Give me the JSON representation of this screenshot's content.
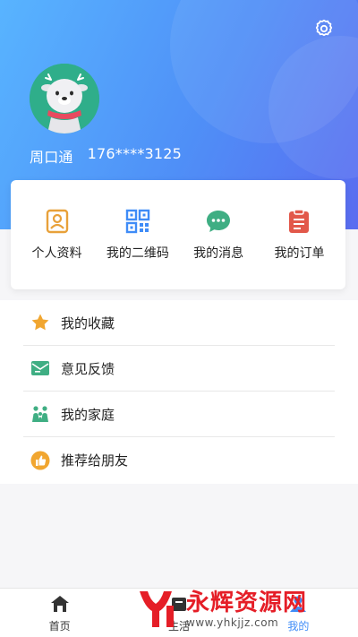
{
  "profile": {
    "name": "周口通",
    "phone": "176****3125"
  },
  "quick_actions": [
    {
      "label": "个人资料",
      "icon": "profile-card-icon",
      "color": "#e8a13a"
    },
    {
      "label": "我的二维码",
      "icon": "qr-code-icon",
      "color": "#3f8cf7"
    },
    {
      "label": "我的消息",
      "icon": "chat-bubble-icon",
      "color": "#3fae83"
    },
    {
      "label": "我的订单",
      "icon": "clipboard-icon",
      "color": "#e2584a"
    }
  ],
  "menu": [
    {
      "label": "我的收藏",
      "icon": "star-icon",
      "color": "#f1a630"
    },
    {
      "label": "意见反馈",
      "icon": "envelope-icon",
      "color": "#3fae83"
    },
    {
      "label": "我的家庭",
      "icon": "family-icon",
      "color": "#3fae83"
    },
    {
      "label": "推荐给朋友",
      "icon": "thumbs-up-icon",
      "color": "#f1a630"
    }
  ],
  "tabs": [
    {
      "label": "首页",
      "icon": "home-icon"
    },
    {
      "label": "生活",
      "icon": "life-icon"
    },
    {
      "label": "我的",
      "icon": "user-icon",
      "active": true
    }
  ],
  "watermark": {
    "title": "永辉资源网",
    "url": "www.yhkjjz.com"
  },
  "colors": {
    "header_start": "#58b4ff",
    "header_end": "#5a6cf0",
    "active_tab": "#3f8cf7",
    "watermark_red": "#e51e27"
  }
}
